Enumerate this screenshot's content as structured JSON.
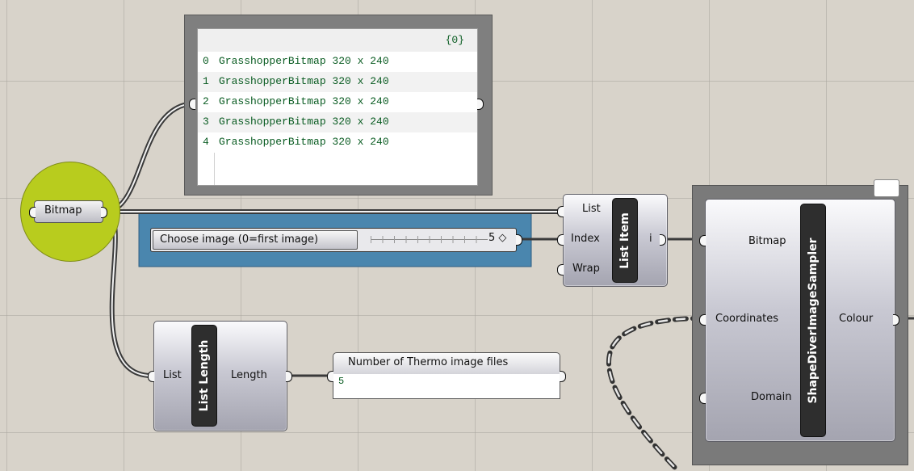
{
  "canvas": {
    "background": "#d8d3ca",
    "grid_color": "#aaa69e"
  },
  "colors": {
    "wire": "#3a3a3a",
    "bitmap_param": "#b8cc1e",
    "slider_group": "#4a86ae",
    "panel_text": "#0a5c22"
  },
  "bitmap_param": {
    "label": "Bitmap"
  },
  "data_panel": {
    "path": "{0}",
    "rows": [
      {
        "index": "0",
        "value": "GrasshopperBitmap 320 x 240"
      },
      {
        "index": "1",
        "value": "GrasshopperBitmap 320 x 240"
      },
      {
        "index": "2",
        "value": "GrasshopperBitmap 320 x 240"
      },
      {
        "index": "3",
        "value": "GrasshopperBitmap 320 x 240"
      },
      {
        "index": "4",
        "value": "GrasshopperBitmap 320 x 240"
      }
    ]
  },
  "slider": {
    "label": "Choose image (0=first image)",
    "value": "5 ◇"
  },
  "list_item": {
    "title": "List Item",
    "inputs": [
      "List",
      "Index",
      "Wrap"
    ],
    "output": "i"
  },
  "list_length": {
    "title": "List Length",
    "input": "List",
    "output": "Length"
  },
  "count_panel": {
    "title": "Number of Thermo image files",
    "value": "5"
  },
  "sampler": {
    "title": "ShapeDiverImageSampler",
    "inputs": [
      "Bitmap",
      "Coordinates",
      "Domain"
    ],
    "output": "Colour"
  }
}
